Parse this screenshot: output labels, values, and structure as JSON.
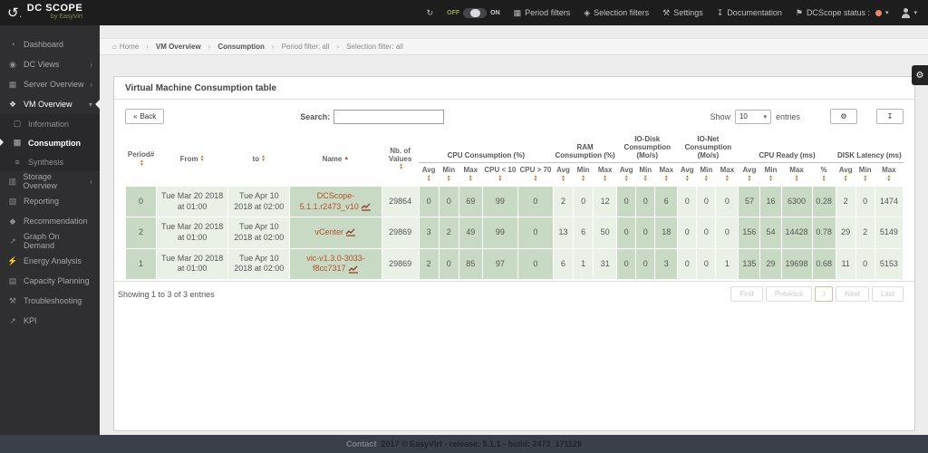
{
  "topbar": {
    "logo_title": "DC SCOPE",
    "logo_subtitle": "by EasyVirt",
    "toggle_off": "OFF",
    "toggle_on": "ON",
    "period_filters": "Period filters",
    "selection_filters": "Selection filters",
    "settings": "Settings",
    "documentation": "Documentation",
    "status_label": "DCScope status :",
    "status_color": "#e9886c"
  },
  "sidebar": {
    "dashboard": "Dashboard",
    "dc_views": "DC Views",
    "server_overview": "Server Overview",
    "vm_overview": "VM Overview",
    "information": "Information",
    "consumption": "Consumption",
    "synthesis": "Synthesis",
    "storage_overview": "Storage Overview",
    "reporting": "Reporting",
    "recommendation": "Recommendation",
    "graph_on_demand": "Graph On Demand",
    "energy_analysis": "Energy Analysis",
    "capacity_planning": "Capacity Planning",
    "troubleshooting": "Troubleshooting",
    "kpi": "KPI"
  },
  "breadcrumb": {
    "home": "Home",
    "vm_overview": "VM Overview",
    "consumption": "Consumption",
    "period_filter": "Period filter: all",
    "selection_filter": "Selection filter: all"
  },
  "panel": {
    "title": "Virtual Machine Consumption table",
    "back_label": "Back",
    "search_label": "Search:",
    "search_value": "",
    "show_label": "Show",
    "page_size": "10",
    "entries_label": "entries",
    "showing": "Showing 1 to 3 of 3 entries",
    "pag_first": "First",
    "pag_previous": "Previous",
    "pag_page": "1",
    "pag_next": "Next",
    "pag_last": "Last"
  },
  "table": {
    "headers": {
      "period": "Period#",
      "from": "From",
      "to": "to",
      "name": "Name",
      "nb": "Nb. of Values",
      "groups": [
        {
          "label": "CPU Consumption (%)",
          "cols": [
            "Avg",
            "Min",
            "Max",
            "CPU < 10",
            "CPU > 70"
          ]
        },
        {
          "label": "RAM Consumption (%)",
          "cols": [
            "Avg",
            "Min",
            "Max"
          ]
        },
        {
          "label": "IO-Disk Consumption (Mo/s)",
          "cols": [
            "Avg",
            "Min",
            "Max"
          ]
        },
        {
          "label": "IO-Net Consumption (Mo/s)",
          "cols": [
            "Avg",
            "Min",
            "Max"
          ]
        },
        {
          "label": "CPU Ready (ms)",
          "cols": [
            "Avg",
            "Min",
            "Max",
            "%"
          ]
        },
        {
          "label": "DISK Latency (ms)",
          "cols": [
            "Avg",
            "Min",
            "Max"
          ]
        }
      ]
    },
    "rows": [
      {
        "period": "0",
        "from": "Tue Mar 20 2018 at 01:00",
        "to": "Tue Apr 10 2018 at 02:00",
        "name": "DCScope-5.1.1.r2473_v10",
        "nb": "29864",
        "cpu": [
          "0",
          "0",
          "69",
          "99",
          "0"
        ],
        "ram": [
          "2",
          "0",
          "12"
        ],
        "iodisk": [
          "0",
          "0",
          "6"
        ],
        "ionet": [
          "0",
          "0",
          "0"
        ],
        "cpuready": [
          "57",
          "16",
          "6300",
          "0.28"
        ],
        "disklat": [
          "2",
          "0",
          "1474"
        ]
      },
      {
        "period": "2",
        "from": "Tue Mar 20 2018 at 01:00",
        "to": "Tue Apr 10 2018 at 02:00",
        "name": "vCenter",
        "nb": "29869",
        "cpu": [
          "3",
          "2",
          "49",
          "99",
          "0"
        ],
        "ram": [
          "13",
          "6",
          "50"
        ],
        "iodisk": [
          "0",
          "0",
          "18"
        ],
        "ionet": [
          "0",
          "0",
          "0"
        ],
        "cpuready": [
          "156",
          "54",
          "14428",
          "0.78"
        ],
        "disklat": [
          "29",
          "2",
          "5149"
        ]
      },
      {
        "period": "1",
        "from": "Tue Mar 20 2018 at 01:00",
        "to": "Tue Apr 10 2018 at 02:00",
        "name": "vic-v1.3.0-3033-f8cc7317",
        "nb": "29869",
        "cpu": [
          "2",
          "0",
          "85",
          "97",
          "0"
        ],
        "ram": [
          "6",
          "1",
          "31"
        ],
        "iodisk": [
          "0",
          "0",
          "3"
        ],
        "ionet": [
          "0",
          "0",
          "1"
        ],
        "cpuready": [
          "135",
          "29",
          "19698",
          "0.68"
        ],
        "disklat": [
          "11",
          "0",
          "5153"
        ]
      }
    ]
  },
  "footer": {
    "contact": "Contact",
    "text": "2017 © EasyVirt - release: 5.1.1 - build: 2473_171129"
  }
}
